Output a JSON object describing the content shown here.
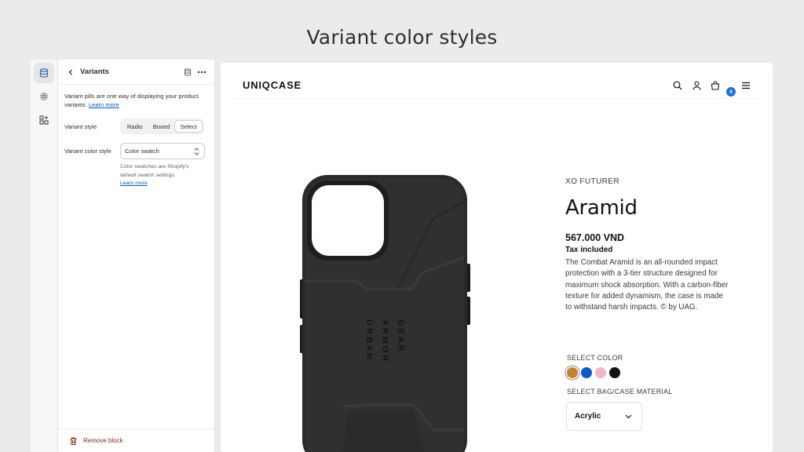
{
  "page": {
    "heading": "Variant color styles"
  },
  "editor": {
    "panel_title": "Variants",
    "description": "Variant pills are one way of displaying your product variants.",
    "learn_more": "Learn more",
    "variant_style": {
      "label": "Variant style",
      "options": [
        "Radio",
        "Boxed",
        "Select"
      ],
      "selected": "Select"
    },
    "variant_color_style": {
      "label": "Variant color style",
      "value": "Color swatch",
      "help": "Color swatches are Shopify's default swatch settings.",
      "learn_more": "Learn more"
    },
    "remove_block": "Remove block"
  },
  "store": {
    "logo": "UNIQCASE",
    "cart_count": "0"
  },
  "product": {
    "vendor": "XO FUTURER",
    "title": "Aramid",
    "price": "567.000 VND",
    "tax": "Tax included",
    "description": "The Combat Aramid is an all-rounded impact protection with a 3-tier structure designed for maximum shock absorption. With a carbon-fiber texture for added dynamism, the case is made to withstand harsh impacts. © by UAG.",
    "case_text": "URBAN ARMOR GEAR",
    "color_label": "SELECT COLOR",
    "colors": [
      "#c8822b",
      "#0f5ad0",
      "#f3b6c4",
      "#111111"
    ],
    "selected_color_index": 0,
    "material_label": "SELECT BAG/CASE MATERIAL",
    "material_value": "Acrylic"
  }
}
